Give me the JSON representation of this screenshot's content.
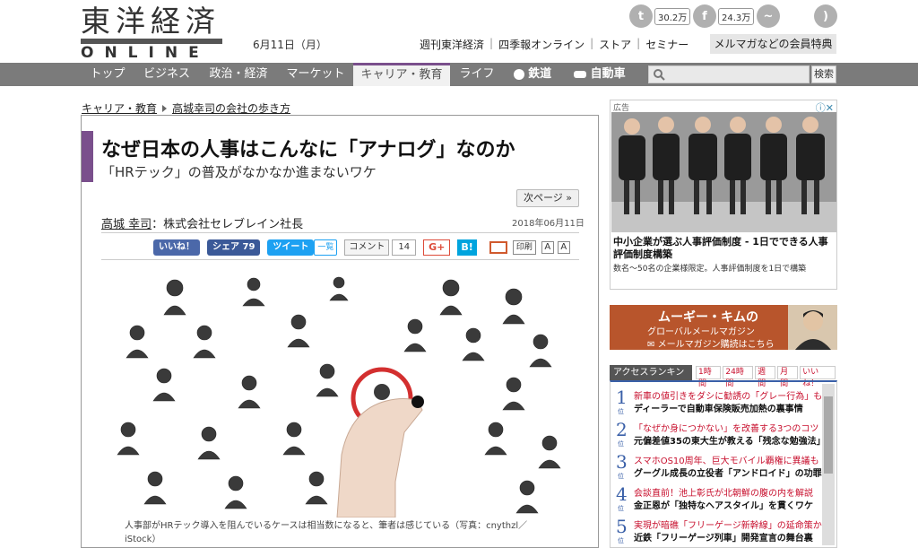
{
  "header": {
    "logo_jp": "東洋経済",
    "logo_en": "ONLINE",
    "date": "6月11日（月）",
    "twitter_count": "30.2万",
    "facebook_count": "24.3万",
    "toplinks": [
      "週刊東洋経済",
      "四季報オンライン",
      "ストア",
      "セミナー"
    ],
    "member_button": "メルマガなどの会員特典"
  },
  "nav": {
    "items": [
      "トップ",
      "ビジネス",
      "政治・経済",
      "マーケット",
      "キャリア・教育",
      "ライフ",
      "鉄道",
      "自動車"
    ],
    "active": "キャリア・教育",
    "search_button": "検索"
  },
  "breadcrumb": [
    "キャリア・教育",
    "高城幸司の会社の歩き方"
  ],
  "article": {
    "title": "なぜ日本の人事はこんなに「アナログ」なのか",
    "subtitle": "「HRテック」の普及がなかなか進まないワケ",
    "next_page": "次ページ »",
    "author_name": "高城 幸司",
    "author_role": "：株式会社セレブレイン社長",
    "pubdate": "2018年06月11日",
    "share": {
      "like": "いいね！",
      "facebook": "シェア 79",
      "tweet": "ツイート",
      "ichiran": "一覧",
      "comment": "コメント",
      "comment_count": "14",
      "gplus": "G+",
      "hatena": "B!",
      "print": "印刷",
      "font_a1": "A",
      "font_a2": "A"
    },
    "caption": "人事部がHRテック導入を阻んでいるケースは相当数になると、筆者は感じている（写真：cnythzl／iStock）"
  },
  "ad": {
    "label": "広告",
    "title": "中小企業が選ぶ人事評価制度 - 1日でできる人事評価制度構築",
    "desc": "数名〜50名の企業様限定。人事評価制度を1日で構築"
  },
  "magazine": {
    "title": "ムーギー・キムの",
    "sub": "グローバルメールマガジン",
    "register": "メールマガジン購読はこちら"
  },
  "ranking": {
    "label": "アクセスランキング",
    "tabs": [
      "1時間",
      "24時間",
      "週間",
      "月間",
      "いいね！"
    ],
    "items": [
      {
        "num": "1",
        "sub": "新車の値引きをダシに勧誘の「グレー行為」も",
        "main": "ディーラーで自動車保険販売加熱の裏事情"
      },
      {
        "num": "2",
        "sub": "「なぜか身につかない」を改善する3つのコツ",
        "main": "元偏差値35の東大生が教える「残念な勉強法」"
      },
      {
        "num": "3",
        "sub": "スマホOS10周年、巨大モバイル覇権に異議も",
        "main": "グーグル成長の立役者「アンドロイド」の功罪"
      },
      {
        "num": "4",
        "sub": "会談直前！池上彰氏が北朝鮮の腹の内を解説",
        "main": "金正恩が「独特なヘアスタイル」を貫くワケ"
      },
      {
        "num": "5",
        "sub": "実現が暗礁「フリーゲージ新幹線」の延命策か",
        "main": "近鉄「フリーゲージ列車」開発宣言の舞台裏"
      }
    ],
    "rank_suffix": "位"
  }
}
